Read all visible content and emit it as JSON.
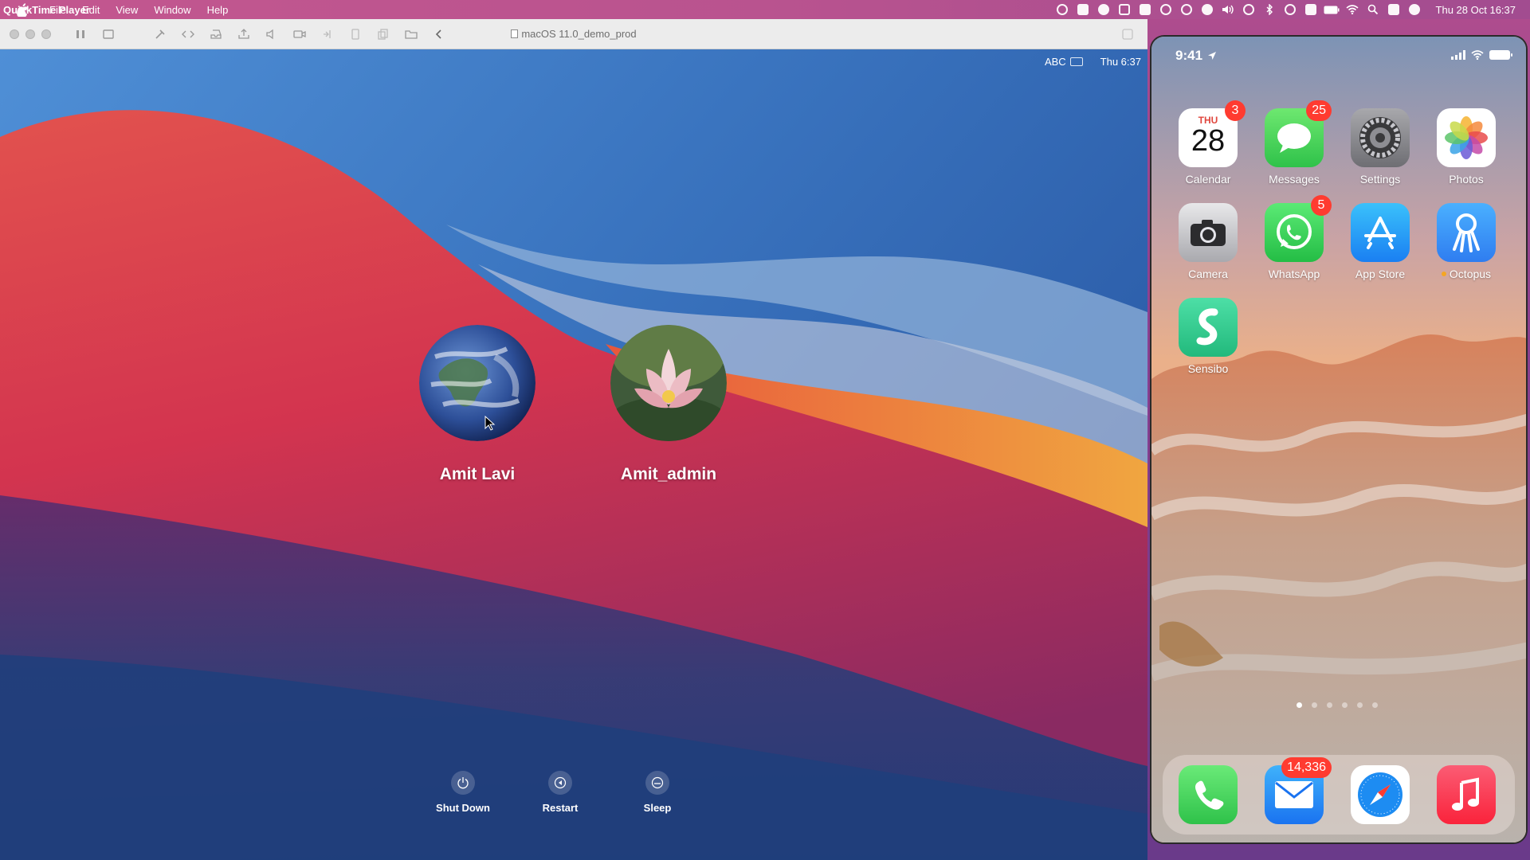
{
  "menubar": {
    "app_name": "QuickTime Player",
    "menus": [
      "File",
      "Edit",
      "View",
      "Window",
      "Help"
    ],
    "clock": "Thu 28 Oct  16:37"
  },
  "window": {
    "title": "macOS 11.0_demo_prod"
  },
  "login_screen": {
    "input_source": "ABC",
    "time": "Thu 6:37",
    "users": [
      {
        "name": "Amit Lavi",
        "avatar": "earth"
      },
      {
        "name": "Amit_admin",
        "avatar": "lotus"
      }
    ],
    "power_buttons": [
      "Shut Down",
      "Restart",
      "Sleep"
    ]
  },
  "iphone": {
    "time": "9:41",
    "apps": [
      {
        "label": "Calendar",
        "badge": "3",
        "day": "THU",
        "date": "28"
      },
      {
        "label": "Messages",
        "badge": "25"
      },
      {
        "label": "Settings",
        "badge": ""
      },
      {
        "label": "Photos",
        "badge": ""
      },
      {
        "label": "Camera",
        "badge": ""
      },
      {
        "label": "WhatsApp",
        "badge": "5"
      },
      {
        "label": "App Store",
        "badge": ""
      },
      {
        "label": "Octopus",
        "badge": ""
      },
      {
        "label": "Sensibo",
        "badge": ""
      }
    ],
    "dock": [
      {
        "name": "phone-app",
        "badge": ""
      },
      {
        "name": "mail-app",
        "badge": "14,336"
      },
      {
        "name": "safari-app",
        "badge": ""
      },
      {
        "name": "music-app",
        "badge": ""
      }
    ],
    "pages": 6,
    "current_page": 1
  },
  "colors": {
    "badge": "#ff3b30",
    "menubar": "#c3578f"
  }
}
